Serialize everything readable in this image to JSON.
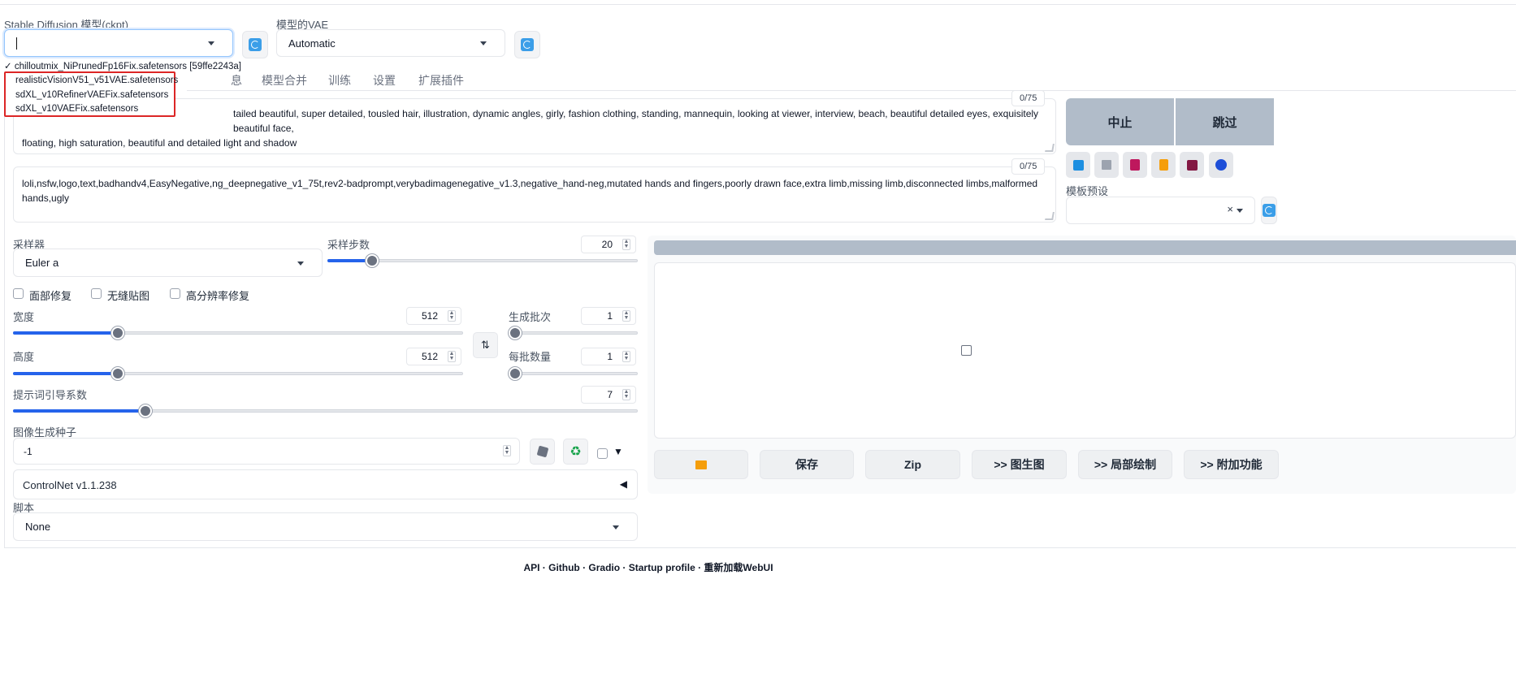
{
  "model": {
    "ckpt_label": "Stable Diffusion 模型(ckpt)",
    "ckpt_value": "",
    "vae_label": "模型的VAE",
    "vae_value": "Automatic"
  },
  "dropdown": {
    "current": "✓ chilloutmix_NiPrunedFp16Fix.safetensors [59ffe2243a]",
    "items": [
      "realisticVisionV51_v51VAE.safetensors",
      "sdXL_v10RefinerVAEFix.safetensors",
      "sdXL_v10VAEFix.safetensors"
    ]
  },
  "tabs": [
    "模型合并",
    "训练",
    "设置",
    "扩展插件"
  ],
  "tab_partial": "息",
  "prompt": {
    "text": "tailed beautiful, super detailed, tousled hair, illustration, dynamic angles, girly, fashion clothing, standing, mannequin, looking at viewer, interview, beach, beautiful detailed eyes, exquisitely beautiful face,",
    "text2": "floating, high saturation, beautiful and detailed light and shadow",
    "counter": "0/75"
  },
  "negative": {
    "text": "loli,nsfw,logo,text,badhandv4,EasyNegative,ng_deepnegative_v1_75t,rev2-badprompt,verybadimagenegative_v1.3,negative_hand-neg,mutated hands and fingers,poorly drawn face,extra limb,missing limb,disconnected limbs,malformed hands,ugly",
    "counter": "0/75"
  },
  "actions": {
    "interrupt": "中止",
    "skip": "跳过"
  },
  "style_label": "模板预设",
  "sampler": {
    "label": "采样器",
    "value": "Euler a"
  },
  "steps": {
    "label": "采样步数",
    "value": "20",
    "fraction": 0.07
  },
  "checkboxes": [
    "面部修复",
    "无缝贴图",
    "高分辨率修复"
  ],
  "width": {
    "label": "宽度",
    "value": "512",
    "fraction": 0.23
  },
  "height": {
    "label": "高度",
    "value": "512",
    "fraction": 0.23
  },
  "batch_count": {
    "label": "生成批次",
    "value": "1",
    "fraction": 0.0
  },
  "batch_size": {
    "label": "每批数量",
    "value": "1",
    "fraction": 0.0
  },
  "cfg": {
    "label": "提示词引导系数",
    "value": "7",
    "fraction": 0.21
  },
  "seed": {
    "label": "图像生成种子",
    "value": "-1"
  },
  "controlnet": {
    "label": "ControlNet v1.1.238"
  },
  "script": {
    "label": "脚本",
    "value": "None"
  },
  "gallery_buttons": [
    "保存",
    "Zip",
    ">> 图生图",
    ">> 局部绘制",
    ">> 附加功能"
  ],
  "footer": "API · Github · Gradio · Startup profile · 重新加载WebUI",
  "colors": {
    "accent": "#2563eb",
    "highlight": "#dc2626",
    "action_bg": "#b1bcc9"
  }
}
